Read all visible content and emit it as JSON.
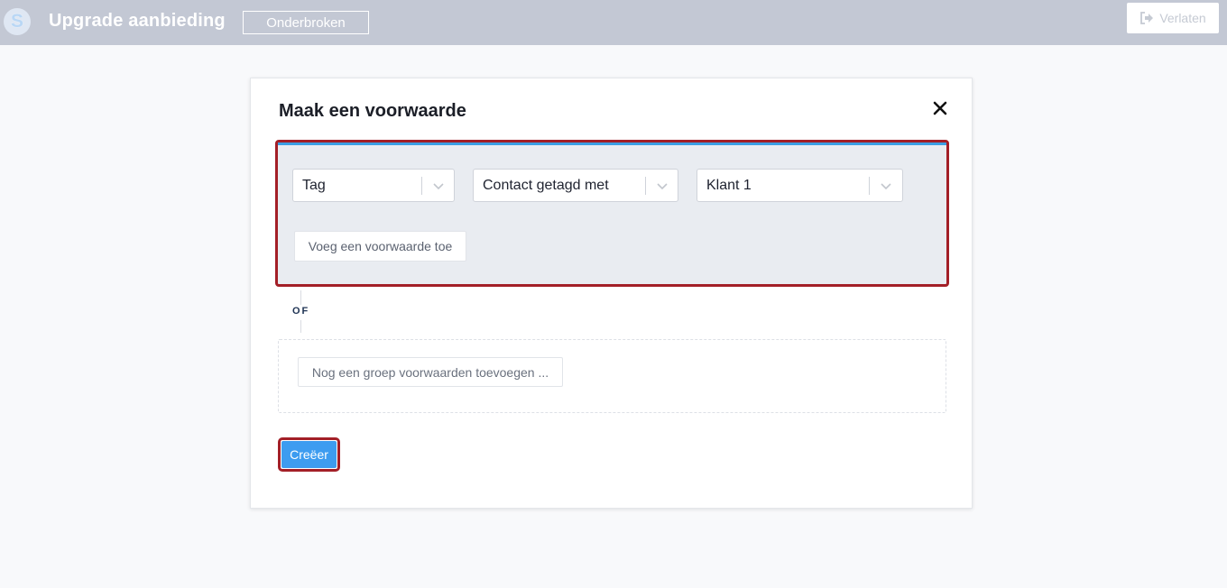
{
  "topbar": {
    "logo_letter": "S",
    "app_title": "Upgrade aanbieding",
    "status_label": "Onderbroken",
    "leave_label": "Verlaten"
  },
  "modal": {
    "title": "Maak een voorwaarde",
    "group": {
      "selects": [
        {
          "value": "Tag"
        },
        {
          "value": "Contact getagd met"
        },
        {
          "value": "Klant 1"
        }
      ],
      "add_condition_label": "Voeg een voorwaarde toe"
    },
    "or_label": "OF",
    "add_group_label": "Nog een groep voorwaarden toevoegen ...",
    "create_label": "Creëer"
  },
  "colors": {
    "topbar": "#c3c8d4",
    "highlight": "#a31f27",
    "primary": "#3d9cf0",
    "accent_line": "#3b9ee4"
  }
}
